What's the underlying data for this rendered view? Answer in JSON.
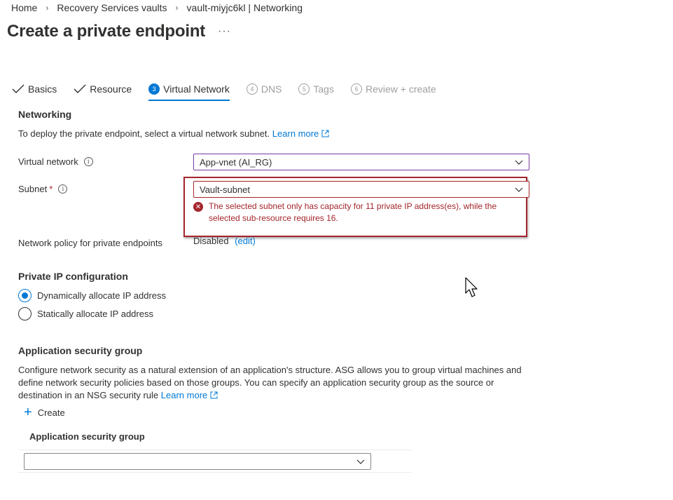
{
  "breadcrumb": [
    "Home",
    "Recovery Services vaults",
    "vault-miyjc6kl | Networking"
  ],
  "title": "Create a private endpoint",
  "more_label": "···",
  "tabs": [
    {
      "label": "Basics",
      "state": "done"
    },
    {
      "label": "Resource",
      "state": "done"
    },
    {
      "num": "3",
      "label": "Virtual Network",
      "state": "active"
    },
    {
      "num": "4",
      "label": "DNS",
      "state": "todo"
    },
    {
      "num": "5",
      "label": "Tags",
      "state": "todo"
    },
    {
      "num": "6",
      "label": "Review + create",
      "state": "todo"
    }
  ],
  "networking": {
    "title": "Networking",
    "description": "To deploy the private endpoint, select a virtual network subnet.",
    "learn_more": "Learn more"
  },
  "fields": {
    "vnet_label": "Virtual network",
    "vnet_value": "App-vnet (AI_RG)",
    "subnet_label": "Subnet",
    "subnet_required": "*",
    "subnet_value": "Vault-subnet",
    "subnet_error": "The selected subnet only has capacity for 11 private IP address(es), while the selected sub-resource requires 16.",
    "policy_label": "Network policy for private endpoints",
    "policy_value": "Disabled",
    "policy_edit": "(edit)"
  },
  "private_ip": {
    "title": "Private IP configuration",
    "dynamic_label": "Dynamically allocate IP address",
    "static_label": "Statically allocate IP address",
    "selected": "dynamic"
  },
  "asg": {
    "title": "Application security group",
    "description": "Configure network security as a natural extension of an application's structure. ASG allows you to group virtual machines and define network security policies based on those groups. You can specify an application security group as the source or destination in an NSG security rule",
    "learn_more": "Learn more",
    "create_label": "Create",
    "column_header": "Application security group",
    "dropdown_value": ""
  },
  "colors": {
    "accent": "#0078d4",
    "error": "#a4262c",
    "text": "#323130"
  }
}
